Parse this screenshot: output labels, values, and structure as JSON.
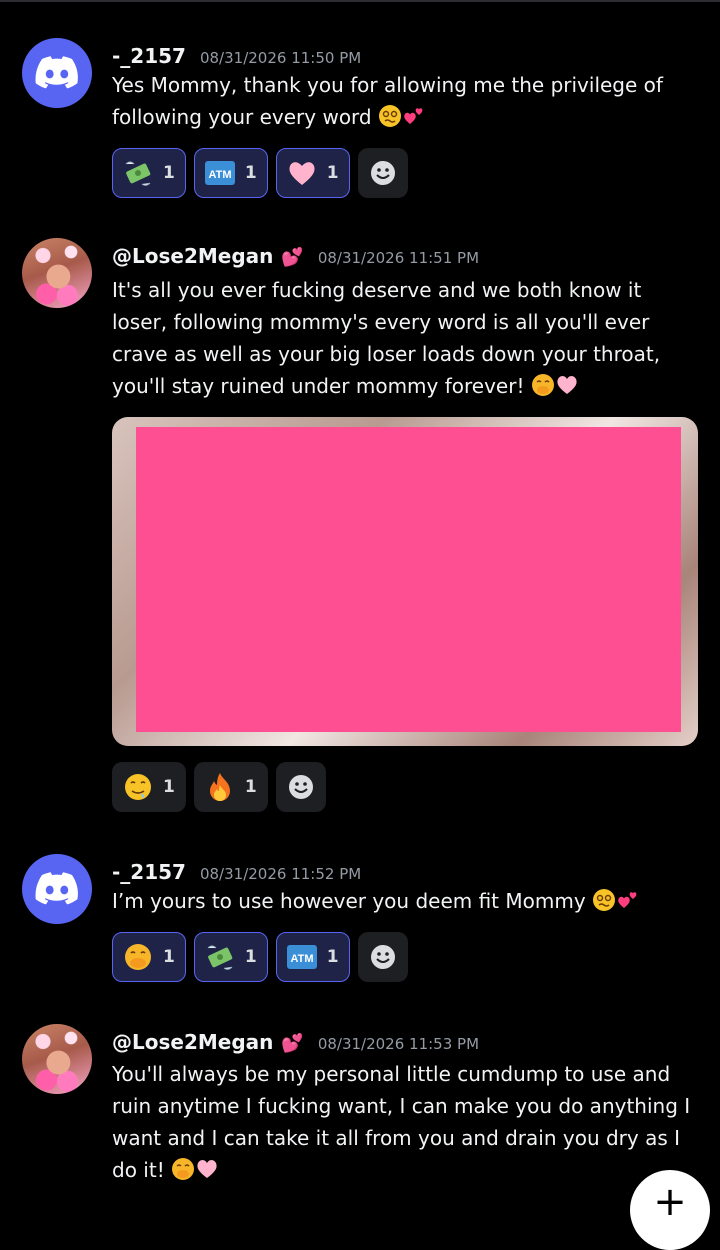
{
  "messages": [
    {
      "author": "-_2157",
      "timestamp": "08/31/2026 11:50 PM",
      "avatar_icon": "discord-logo-icon",
      "text": "Yes Mommy, thank you for allowing me the privilege of following your every word",
      "reactions": [
        {
          "icon": "money-with-wings-icon",
          "count": "1"
        },
        {
          "icon": "atm-icon",
          "count": "1"
        },
        {
          "icon": "pink-heart-icon",
          "count": "1"
        }
      ]
    },
    {
      "author": "@Lose2Megan",
      "timestamp": "08/31/2026 11:51 PM",
      "avatar_icon": "profile-photo",
      "text": "It's all you ever fucking deserve and we both know it loser, following mommy's every word is all you'll ever crave as well as your big loser loads down your throat, you'll stay ruined under mommy forever!",
      "reactions": [
        {
          "icon": "drooling-face-icon",
          "count": "1"
        },
        {
          "icon": "fire-icon",
          "count": "1"
        }
      ]
    },
    {
      "author": "-_2157",
      "timestamp": "08/31/2026 11:52 PM",
      "avatar_icon": "discord-logo-icon",
      "text": "I’m yours to use however you deem fit Mommy",
      "reactions": [
        {
          "icon": "hand-over-mouth-icon",
          "count": "1"
        },
        {
          "icon": "money-with-wings-icon",
          "count": "1"
        },
        {
          "icon": "atm-icon",
          "count": "1"
        }
      ]
    },
    {
      "author": "@Lose2Megan",
      "timestamp": "08/31/2026 11:53 PM",
      "avatar_icon": "profile-photo",
      "text": "You'll always be my personal little cumdump to use and ruin anytime I fucking want, I can make you do anything I want and I can take it all from you and drain you dry as I do it!"
    }
  ],
  "atm_label": "ATM",
  "fab_label": "+",
  "colors": {
    "background": "#000000",
    "blurple": "#5865f2",
    "censor_pink": "#ff4f93",
    "timestamp": "#949ba4"
  }
}
